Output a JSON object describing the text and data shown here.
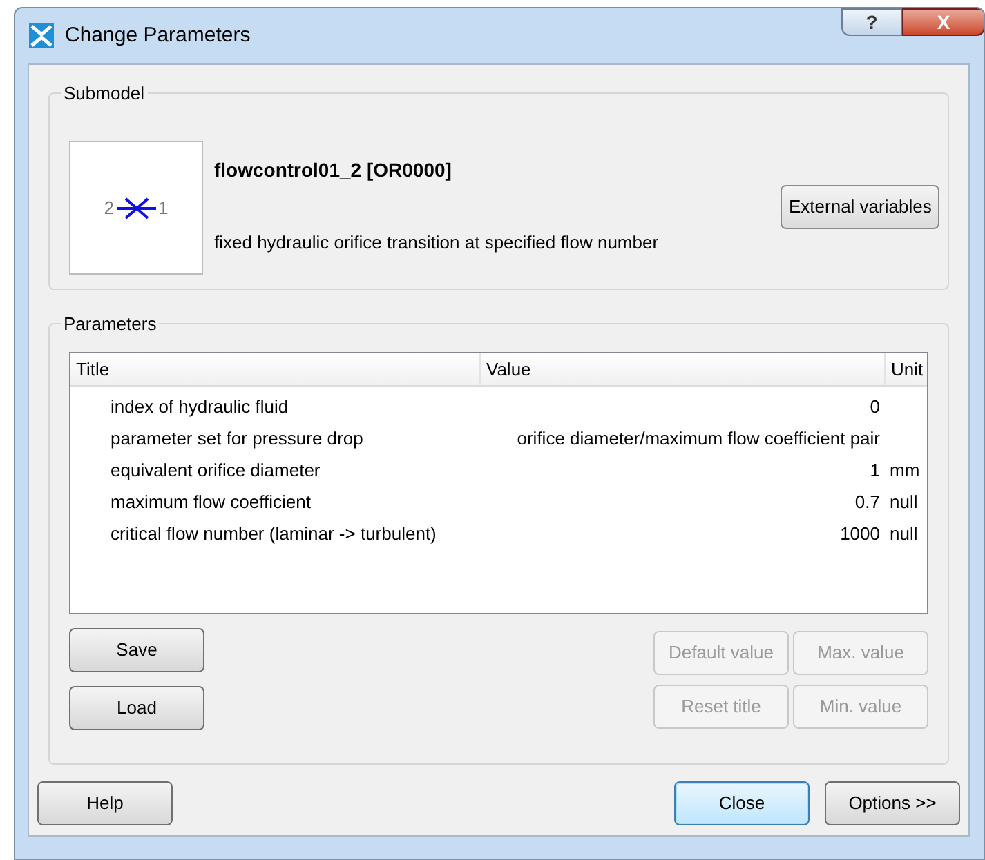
{
  "window": {
    "title": "Change Parameters",
    "title_buttons": [
      "?",
      "X"
    ]
  },
  "submodel": {
    "legend": "Submodel",
    "diagram": {
      "left_port": "2",
      "right_port": "1"
    },
    "name": "flowcontrol01_2 [OR0000]",
    "description": "fixed hydraulic orifice transition at specified flow number",
    "button": "External variables"
  },
  "parameters": {
    "legend": "Parameters",
    "table": {
      "columns": [
        "Title",
        "Value",
        "Unit"
      ],
      "rows": [
        {
          "title": "index of hydraulic fluid",
          "value": "0",
          "unit": ""
        },
        {
          "title": "parameter set for pressure drop",
          "value": "orifice diameter/maximum flow coefficient pair",
          "unit": ""
        },
        {
          "title": "equivalent orifice diameter",
          "value": "1",
          "unit": "mm"
        },
        {
          "title": "maximum flow coefficient",
          "value": "0.7",
          "unit": "null"
        },
        {
          "title": "critical flow number (laminar -> turbulent)",
          "value": "1000",
          "unit": "null"
        }
      ]
    },
    "left_buttons": [
      {
        "label": "Save",
        "disabled": false
      },
      {
        "label": "Load",
        "disabled": false
      }
    ],
    "right_buttons": [
      {
        "label": "Default value",
        "disabled": true
      },
      {
        "label": "Max. value",
        "disabled": true
      },
      {
        "label": "Reset title",
        "disabled": true
      },
      {
        "label": "Min. value",
        "disabled": true
      }
    ]
  },
  "footer_buttons": [
    {
      "label": "Help",
      "default": false
    },
    {
      "label": "Close",
      "default": true
    },
    {
      "label": "Options >>",
      "default": false
    }
  ]
}
